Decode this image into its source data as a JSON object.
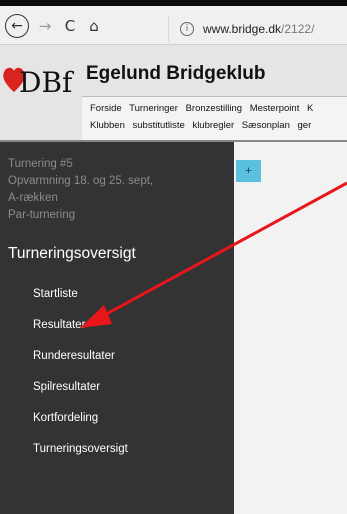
{
  "browser": {
    "back_label": "←",
    "forward_label": "→",
    "reload_label": "C",
    "home_label": "⌂",
    "info_label": "i",
    "url_domain": "www.bridge.dk",
    "url_path": "/2122/"
  },
  "site": {
    "title": "Egelund Bridgeklub",
    "logo_text": "DBf",
    "nav_row1": [
      "Forside",
      "Turneringer",
      "Bronzestilling",
      "Mesterpoint",
      "K"
    ],
    "nav_row2": [
      "Klubben",
      "substitutliste",
      "klubregler",
      "Sæsonplan",
      "ger"
    ]
  },
  "tournament": {
    "number": "Turnering #5",
    "name": "Opvarmning 18. og 25. sept,",
    "group": "A-rækken",
    "type": "Par-turnering"
  },
  "sidebar": {
    "heading": "Turneringsoversigt",
    "items": [
      {
        "label": "Startliste"
      },
      {
        "label": "Resultater"
      },
      {
        "label": "Runderesultater"
      },
      {
        "label": "Spilresultater"
      },
      {
        "label": "Kortfordeling"
      },
      {
        "label": "Turneringsoversigt"
      }
    ]
  },
  "main": {
    "add_button_label": "+"
  },
  "colors": {
    "sidebar_bg": "#333333",
    "accent_button": "#5bc0de",
    "annotation_arrow": "#e8161b",
    "logo_heart": "#d9231e"
  },
  "icons": [
    "back-icon",
    "forward-icon",
    "reload-icon",
    "home-icon",
    "info-icon",
    "dbf-logo-heart"
  ]
}
